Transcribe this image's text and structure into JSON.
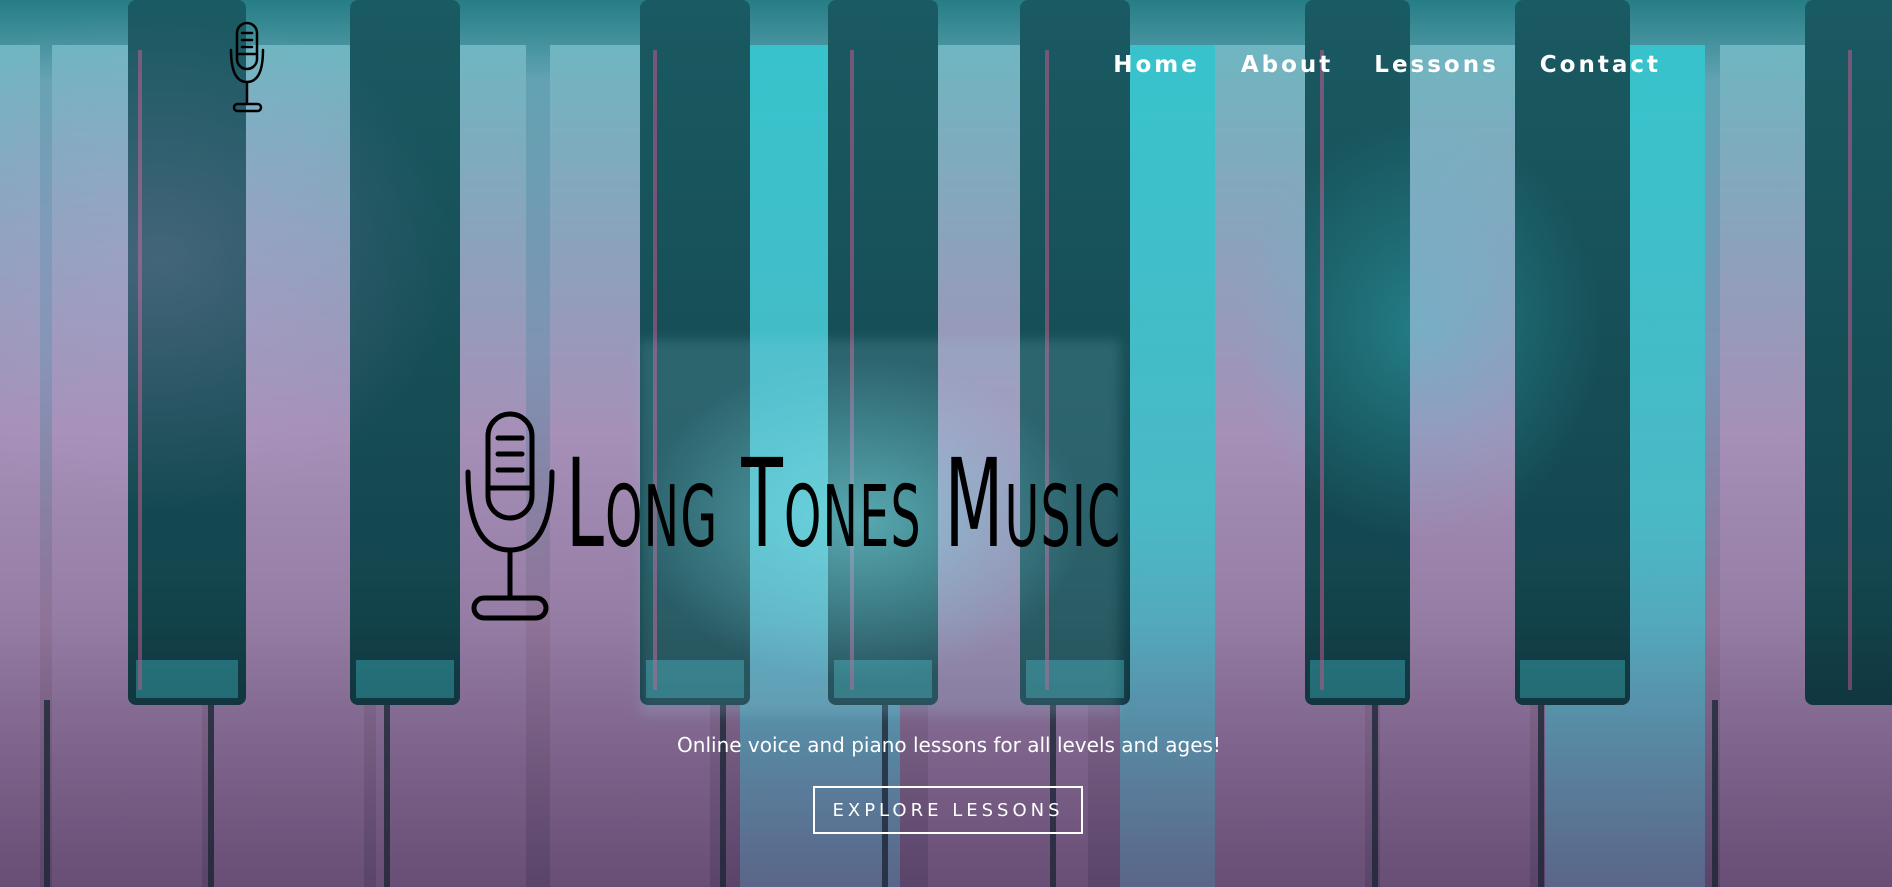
{
  "nav": {
    "items": [
      {
        "label": "Home"
      },
      {
        "label": "About"
      },
      {
        "label": "Lessons"
      },
      {
        "label": "Contact"
      }
    ]
  },
  "hero": {
    "title": "Long Tones Music",
    "tagline": "Online voice and piano lessons for all levels and ages!",
    "cta_label": "EXPLORE LESSONS"
  },
  "icons": {
    "logo": "microphone-icon",
    "hero_logo": "microphone-icon"
  },
  "colors": {
    "nav_text": "#ffffff",
    "title_text": "#000000",
    "teal": "#2fa9b3",
    "pink": "#b48fb4"
  }
}
